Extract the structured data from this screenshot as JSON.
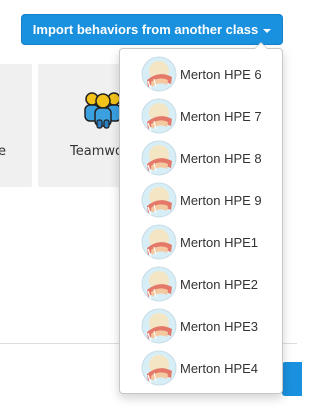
{
  "import_button": {
    "label": "Import behaviors from another class",
    "icon": "caret-down-icon",
    "color": "#1a91de"
  },
  "tiles": [
    {
      "label": "e"
    },
    {
      "label": "Teamwo",
      "icon": "team-people-icon"
    }
  ],
  "dropdown": {
    "items": [
      {
        "label": "Merton HPE 6",
        "icon": "class-avatar-icon"
      },
      {
        "label": "Merton HPE 7",
        "icon": "class-avatar-icon"
      },
      {
        "label": "Merton HPE 8",
        "icon": "class-avatar-icon"
      },
      {
        "label": "Merton HPE 9",
        "icon": "class-avatar-icon"
      },
      {
        "label": "Merton HPE1",
        "icon": "class-avatar-icon"
      },
      {
        "label": "Merton HPE2",
        "icon": "class-avatar-icon"
      },
      {
        "label": "Merton HPE3",
        "icon": "class-avatar-icon"
      },
      {
        "label": "Merton HPE4",
        "icon": "class-avatar-icon"
      }
    ]
  }
}
